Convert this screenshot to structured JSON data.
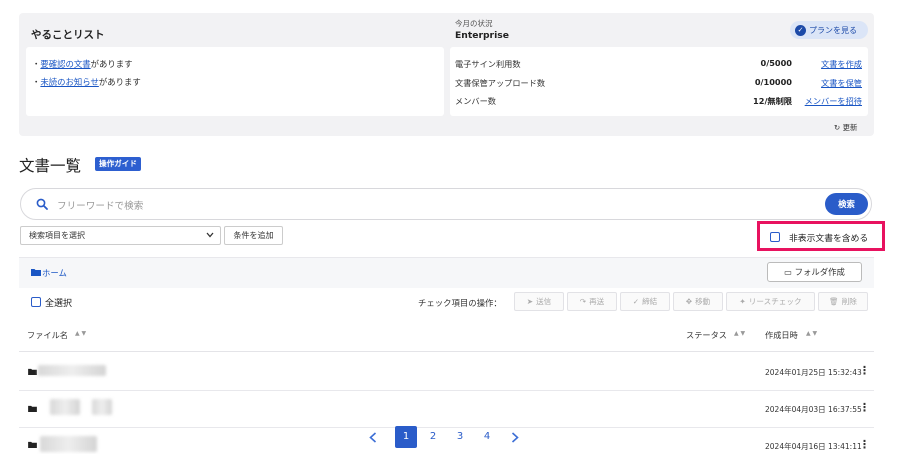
{
  "todo": {
    "title": "やることリスト",
    "items": [
      {
        "bullet": "・",
        "link": "要確認の文書",
        "suffix": "があります"
      },
      {
        "bullet": "・",
        "link": "未読のお知らせ",
        "suffix": "があります"
      }
    ]
  },
  "status": {
    "caption": "今月の状況",
    "plan": "Enterprise",
    "plan_button": "プランを見る",
    "rows": [
      {
        "label": "電子サイン利用数",
        "value": "0/5000",
        "link": "文書を作成"
      },
      {
        "label": "文書保管アップロード数",
        "value": "0/10000",
        "link": "文書を保管"
      },
      {
        "label": "メンバー数",
        "value": "12/無制限",
        "link": "メンバーを招待"
      }
    ],
    "refresh": "更新"
  },
  "list": {
    "title": "文書一覧",
    "guide": "操作ガイド"
  },
  "search": {
    "placeholder": "フリーワードで検索",
    "button": "検索",
    "select_label": "検索項目を選択",
    "add_condition": "条件を追加",
    "include_hidden": "非表示文書を含める"
  },
  "files": {
    "home": "ホーム",
    "create_folder": "フォルダ作成",
    "select_all": "全選択",
    "ops_label": "チェック項目の操作：",
    "ops": [
      "送信",
      "再送",
      "締結",
      "移動",
      "リースチェック",
      "削除"
    ],
    "columns": {
      "name": "ファイル名",
      "status": "ステータス",
      "created": "作成日時"
    },
    "rows": [
      {
        "date": "2024年01月25日 15:32:43"
      },
      {
        "date": "2024年04月03日 16:37:55"
      },
      {
        "date": "2024年04月16日 13:41:11"
      }
    ]
  },
  "pagination": {
    "pages": [
      "1",
      "2",
      "3",
      "4"
    ],
    "current": "1"
  },
  "colors": {
    "accent": "#2a5cc9",
    "highlight": "#e8125f"
  }
}
